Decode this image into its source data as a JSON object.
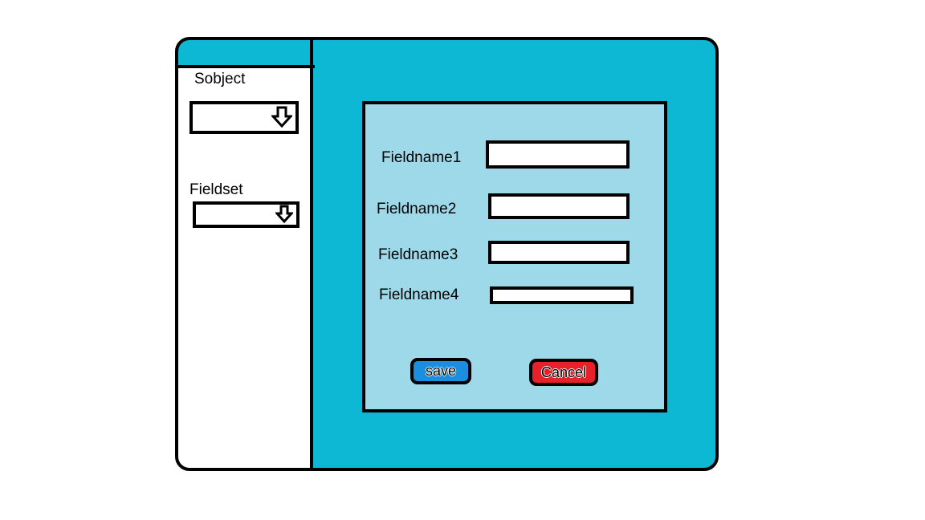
{
  "sidebar": {
    "object_label": "Sobject",
    "object_select": {
      "selected_value": "",
      "icon": "arrow-down-icon"
    },
    "fieldset_label": "Fieldset",
    "fieldset_select": {
      "selected_value": "",
      "icon": "arrow-down-icon"
    }
  },
  "form": {
    "fields": [
      {
        "label": "Fieldname1",
        "value": ""
      },
      {
        "label": "Fieldname2",
        "value": ""
      },
      {
        "label": "Fieldname3",
        "value": ""
      },
      {
        "label": "Fieldname4",
        "value": ""
      }
    ],
    "save_label": "save",
    "cancel_label": "Cancel"
  },
  "colors": {
    "window_bg": "#0db8d4",
    "panel_bg": "#9ed9ea",
    "save_button": "#1a8fe0",
    "cancel_button": "#e8202a"
  }
}
